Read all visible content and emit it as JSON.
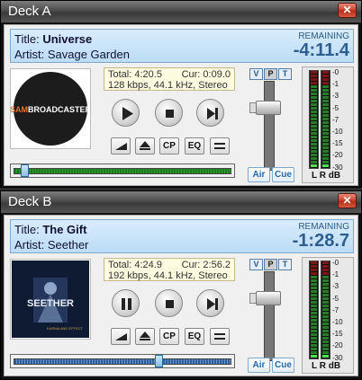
{
  "decks": [
    {
      "window_title": "Deck A",
      "close_symbol": "✕",
      "title_label": "Title:",
      "title": "Universe",
      "artist_label": "Artist:",
      "artist": "Savage Garden",
      "remaining_label": "REMAINING",
      "remaining": "-4:11.4",
      "total": "Total: 4:20.5",
      "current": "Cur: 0:09.0",
      "format": "128 kbps, 44.1 kHz, Stereo",
      "art_text_1": "SAM",
      "art_text_2": "BROADCASTER",
      "state": "stopped",
      "seek_fraction": 0.035,
      "seek_style": "green",
      "fader_level": 0.74,
      "meter_levels": [
        0.02,
        0.02
      ],
      "buttons": {
        "cp": "CP",
        "eq": "EQ",
        "v": "V",
        "p": "P",
        "t": "T",
        "air": "Air",
        "cue": "Cue"
      }
    },
    {
      "window_title": "Deck B",
      "close_symbol": "✕",
      "title_label": "Title:",
      "title": "The Gift",
      "artist_label": "Artist:",
      "artist": "Seether",
      "remaining_label": "REMAINING",
      "remaining": "-1:28.7",
      "total": "Total: 4:24.9",
      "current": "Cur: 2:56.2",
      "format": "192 kbps, 44.1 kHz, Stereo",
      "art_text_1": "SEETHER",
      "art_text_2": "KARMA AND EFFECT",
      "state": "playing",
      "seek_fraction": 0.655,
      "seek_style": "blue",
      "fader_level": 0.74,
      "meter_levels": [
        0.02,
        0.02
      ],
      "buttons": {
        "cp": "CP",
        "eq": "EQ",
        "v": "V",
        "p": "P",
        "t": "T",
        "air": "Air",
        "cue": "Cue"
      }
    }
  ],
  "meter_scale": [
    "-0",
    "-1",
    "-3",
    "-5",
    "-7",
    "-10",
    "-15",
    "-20",
    "-30"
  ],
  "meter_footer": "L R dB",
  "colors": {
    "accent": "#2e5e8e",
    "meter_green": "#2fb52f",
    "meter_red": "#c02020",
    "seek_green": "#1f7a1f",
    "seek_blue": "#3a7ac0"
  }
}
